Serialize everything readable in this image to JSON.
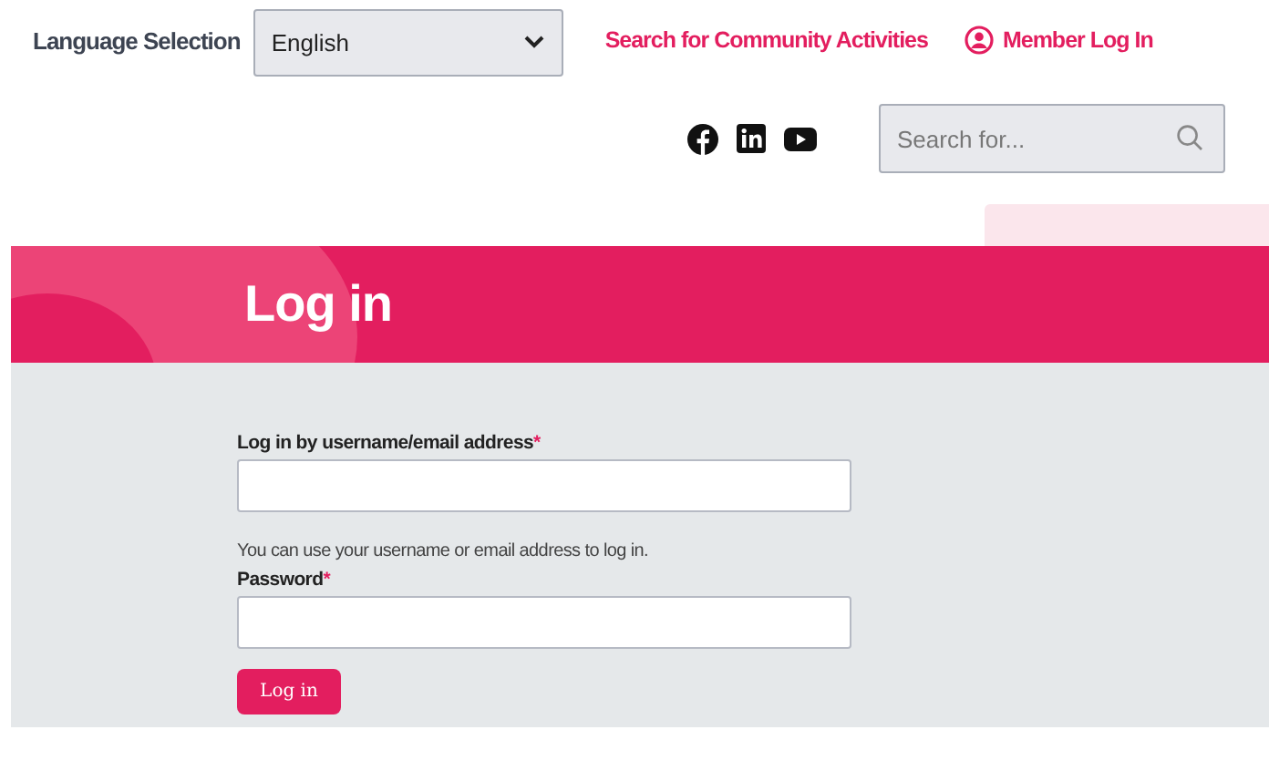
{
  "header": {
    "language_label": "Language Selection",
    "language_value": "English",
    "links": [
      {
        "label": "Search for Community Activities",
        "kind": "plain"
      },
      {
        "label": "Member Log In",
        "kind": "user"
      }
    ],
    "social": [
      {
        "kind": "facebook"
      },
      {
        "kind": "linkedin"
      },
      {
        "kind": "youtube"
      }
    ],
    "search": {
      "placeholder": "Search for..."
    }
  },
  "banner": {
    "title": "Log in"
  },
  "form": {
    "fields": [
      {
        "label": "Log in by username/email address",
        "required_mark": "*",
        "help": "You can use your username or email address to log in."
      },
      {
        "label": "Password",
        "required_mark": "*"
      }
    ],
    "submit": "Log in"
  }
}
